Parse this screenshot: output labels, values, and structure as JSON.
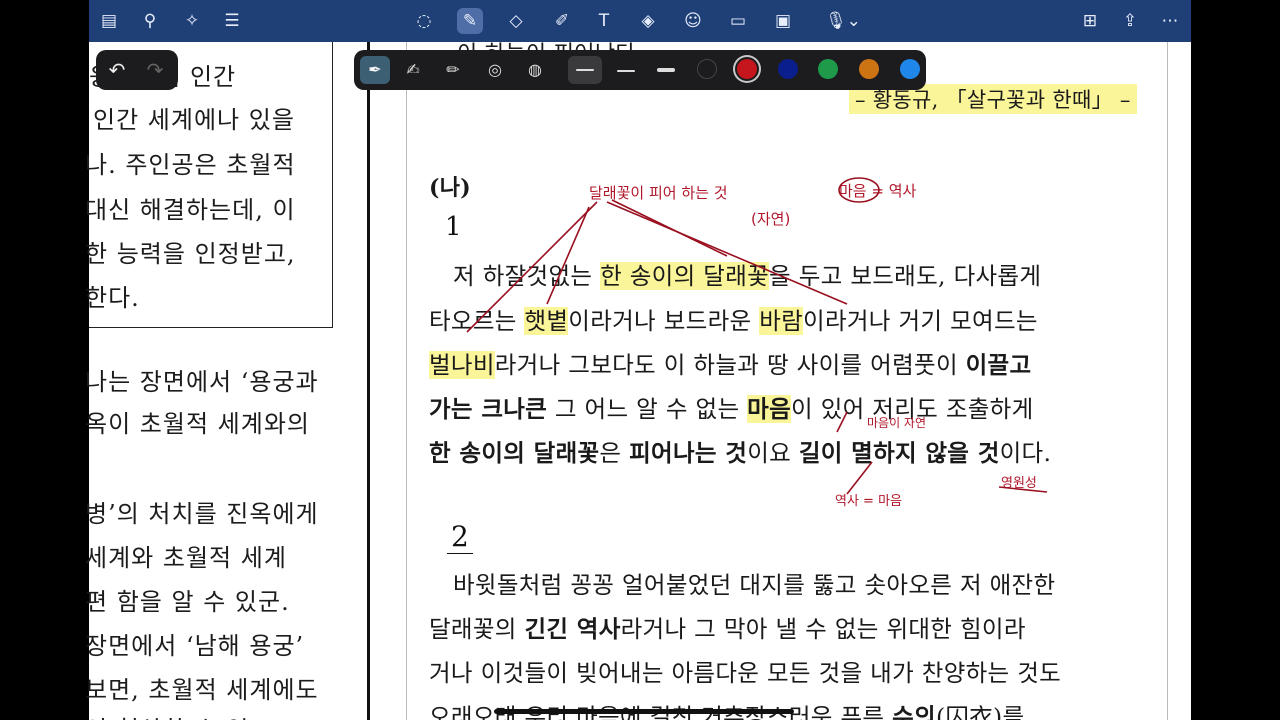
{
  "toolbar": {
    "icons": [
      "sidebar-icon",
      "search-icon",
      "sparkle-icon",
      "document-list-icon",
      "lasso-icon",
      "pen-icon",
      "eraser-icon",
      "highlighter-icon",
      "text-icon",
      "shapes-icon",
      "sticker-icon",
      "note-icon",
      "image-icon",
      "mic-icon",
      "add-page-icon",
      "share-icon",
      "more-icon"
    ]
  },
  "pen_toolbar": {
    "colors": [
      "#1c1c1e",
      "#c4161c",
      "#0b1f8c",
      "#1e9a4a",
      "#cc7414",
      "#1f86ea"
    ],
    "selected_color": "#c4161c"
  },
  "left_page": {
    "box_lines": [
      "웅서처럼 인간",
      "인간 세계에나 있을",
      "나. 주인공은 초월적",
      "대신 해결하는데, 이",
      "한 능력을 인정받고,",
      "한다."
    ],
    "lines": [
      "나는 장면에서 ‘용궁과",
      "옥이 초월적 세계와의",
      "",
      "병’의 처치를 진옥에게",
      "세계와 초월적 세계",
      "편 함을 알 수 있군.",
      "장면에서 ‘남해 용궁’",
      "보면, 초월적 세계에도",
      "이 형상화 수 있고"
    ]
  },
  "center_page": {
    "top_line": "이 하늘이 피어난다",
    "citation": "– 황동규, 「살구꽃과 한때」 –",
    "section_label": "(나)",
    "number_1": "1",
    "number_2": "2",
    "p1": {
      "l1_a": "저 하잘것없는 ",
      "l1_hl": "한 송이의 달래꽃",
      "l1_b": "을 두고 보드래도, 다사롭게",
      "l2_a": "타오르는 ",
      "l2_hl1": "햇볕",
      "l2_b": "이라거나 보드라운 ",
      "l2_hl2": "바람",
      "l2_c": "이라거나 거기 모여드는",
      "l3_hl": "벌나비",
      "l3_a": "라거나 그보다도 이 하늘과 땅 사이를 어렴풋이 ",
      "l3_b": "이끌고",
      "l4_b1": "가는 크나큰",
      "l4_a": " 그 어느 알 수 없는 ",
      "l4_hl": "마음",
      "l4_c": "이 있어 저리도 조출하게",
      "l5_b1": "한 송이의 달래꽃",
      "l5_a": "은 ",
      "l5_b2": "피어나는 것",
      "l5_c": "이요 ",
      "l5_b3": "길이 멸하지 않을 것",
      "l5_d": "이다."
    },
    "p2": {
      "l1": "바윗돌처럼 꽁꽁 얼어붙었던 대지를 뚫고 솟아오른 저 애잔한",
      "l2_a": "달래꽃의 ",
      "l2_b": "긴긴 역사",
      "l2_c": "라거나 그 막아 낼 수 없는 위대한 힘이라",
      "l3": "거나 이것들이 빚어내는 아름다운 모든 것을 내가 찬양하는 것도",
      "l4_a": "오래오래 우리 마음에 걸친 거추장스러운 푸른 ",
      "l4_b": "수의",
      "l4_c": "(囚衣)를"
    },
    "annotations": {
      "a1": "달래꽃이 피어 하는 것",
      "a1_sub": "(자연)",
      "a2": "마음 = 역사",
      "a3": "마음이 자연",
      "a4": "역사 = 마음",
      "a5": "영원성"
    }
  }
}
